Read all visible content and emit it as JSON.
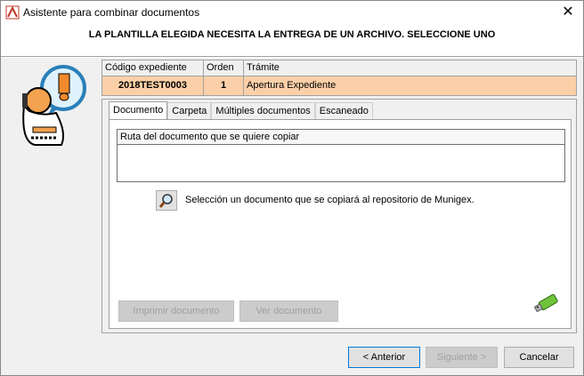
{
  "window": {
    "title": "Asistente para combinar documentos",
    "close_glyph": "✕"
  },
  "header": {
    "text": "LA PLANTILLA ELEGIDA NECESITA LA ENTREGA DE UN ARCHIVO. SELECCIONE UNO"
  },
  "grid": {
    "columns": [
      "Código expediente",
      "Orden",
      "Trámite"
    ],
    "row": {
      "codigo": "2018TEST0003",
      "orden": "1",
      "tramite": "Apertura Expediente"
    },
    "row_color": "#fbd0a8"
  },
  "tabs": [
    {
      "label": "Documento",
      "active": true
    },
    {
      "label": "Carpeta",
      "active": false
    },
    {
      "label": "Múltiples documentos",
      "active": false
    },
    {
      "label": "Escaneado",
      "active": false
    }
  ],
  "document_tab": {
    "path_label": "Ruta del documento que se quiere copiar",
    "path_value": "",
    "hint": "Selección un documento que se copiará al repositorio de Munigex.",
    "print_button": "Imprimir documento",
    "view_button": "Ver documento",
    "icons": {
      "search": "magnifier-icon",
      "usb": "usb-drive-icon"
    }
  },
  "footer": {
    "back": "< Anterior",
    "next": "Siguiente >",
    "cancel": "Cancelar"
  }
}
